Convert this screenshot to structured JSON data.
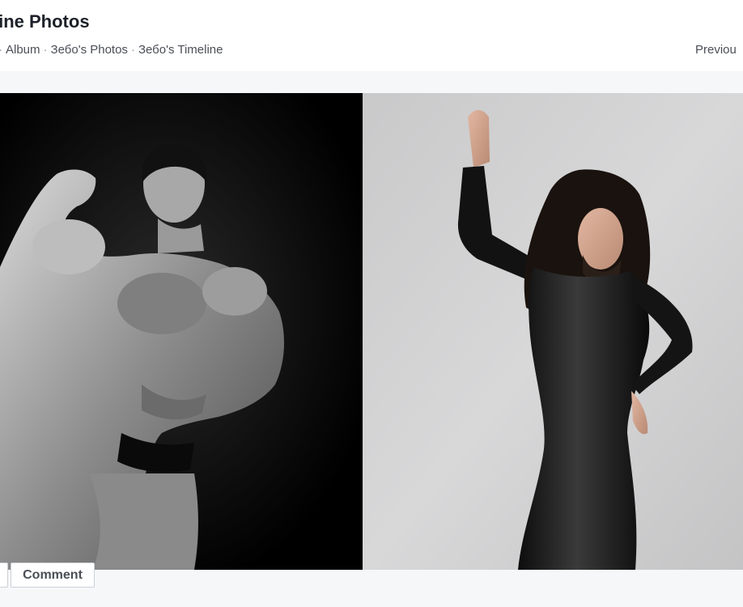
{
  "header": {
    "title": "line Photos",
    "breadcrumbs": [
      {
        "label": "Album"
      },
      {
        "label": "Зебо's Photos"
      },
      {
        "label": "Зебо's Timeline"
      }
    ],
    "separator": "·",
    "previous_label": "Previou"
  },
  "photo": {
    "left_background": "#000000",
    "right_background": "#cfcfd0"
  },
  "actions": {
    "like_label": "",
    "comment_label": "Comment"
  },
  "colors": {
    "text_primary": "#1d2129",
    "text_secondary": "#4b4f56",
    "toolbar_bg": "#f6f7f9",
    "button_border": "#ccd0d5"
  }
}
